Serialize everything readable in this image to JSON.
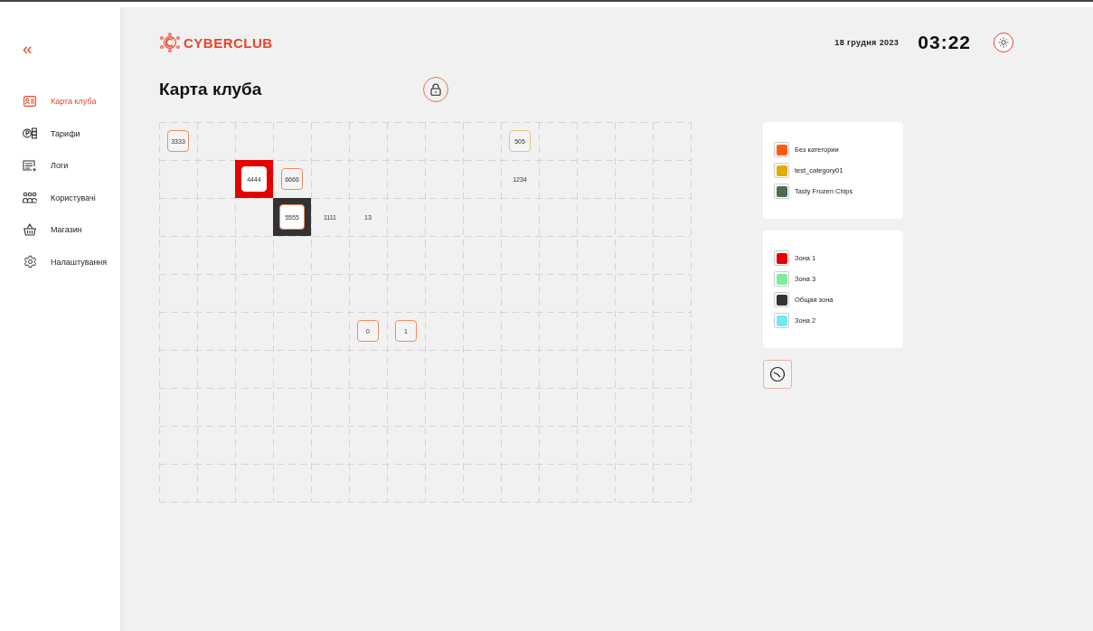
{
  "sidebar": {
    "collapse": "«",
    "items": [
      {
        "label": "Карта клуба",
        "selected": true
      },
      {
        "label": "Тарифи",
        "selected": false
      },
      {
        "label": "Логи",
        "selected": false
      },
      {
        "label": "Користувачі",
        "selected": false
      },
      {
        "label": "Магазин",
        "selected": false
      },
      {
        "label": "Налаштування",
        "selected": false
      }
    ]
  },
  "header": {
    "logo": "CYBERCLUB",
    "date": "18 грудня 2023",
    "time": "03:22"
  },
  "page": {
    "title": "Карта клуба"
  },
  "map": {
    "rows": [
      [
        {
          "kind": "seat",
          "label": "3333",
          "color": "#f08a5d"
        },
        {
          "kind": "empty"
        },
        {
          "kind": "empty"
        },
        {
          "kind": "empty"
        },
        {
          "kind": "empty"
        },
        {
          "kind": "empty"
        },
        {
          "kind": "empty"
        },
        {
          "kind": "empty"
        },
        {
          "kind": "empty"
        },
        {
          "kind": "seat",
          "label": "505",
          "color": "#e2c77a"
        },
        {
          "kind": "empty"
        },
        {
          "kind": "empty"
        },
        {
          "kind": "empty"
        },
        {
          "kind": "empty"
        }
      ],
      [
        {
          "kind": "empty"
        },
        {
          "kind": "empty"
        },
        {
          "kind": "seat",
          "label": "4444",
          "color": "#ffffff",
          "zone": {
            "color": "#e60000"
          }
        },
        {
          "kind": "seat",
          "label": "6666",
          "color": "#f08a5d"
        },
        {
          "kind": "empty"
        },
        {
          "kind": "empty"
        },
        {
          "kind": "empty"
        },
        {
          "kind": "empty"
        },
        {
          "kind": "empty"
        },
        {
          "kind": "text",
          "label": "1234"
        },
        {
          "kind": "empty"
        },
        {
          "kind": "empty"
        },
        {
          "kind": "empty"
        },
        {
          "kind": "empty"
        }
      ],
      [
        {
          "kind": "empty"
        },
        {
          "kind": "empty"
        },
        {
          "kind": "empty"
        },
        {
          "kind": "seat",
          "label": "5555",
          "color": "#f08a5d",
          "zone": {
            "color": "#333333"
          }
        },
        {
          "kind": "text",
          "label": "1111"
        },
        {
          "kind": "text",
          "label": "13"
        },
        {
          "kind": "empty"
        },
        {
          "kind": "empty"
        },
        {
          "kind": "empty"
        },
        {
          "kind": "empty"
        },
        {
          "kind": "empty"
        },
        {
          "kind": "empty"
        },
        {
          "kind": "empty"
        },
        {
          "kind": "empty"
        }
      ],
      [
        {
          "kind": "empty"
        },
        {
          "kind": "empty"
        },
        {
          "kind": "empty"
        },
        {
          "kind": "empty"
        },
        {
          "kind": "empty"
        },
        {
          "kind": "empty"
        },
        {
          "kind": "empty"
        },
        {
          "kind": "empty"
        },
        {
          "kind": "empty"
        },
        {
          "kind": "empty"
        },
        {
          "kind": "empty"
        },
        {
          "kind": "empty"
        },
        {
          "kind": "empty"
        },
        {
          "kind": "empty"
        }
      ],
      [
        {
          "kind": "empty"
        },
        {
          "kind": "empty"
        },
        {
          "kind": "empty"
        },
        {
          "kind": "empty"
        },
        {
          "kind": "empty"
        },
        {
          "kind": "empty"
        },
        {
          "kind": "empty"
        },
        {
          "kind": "empty"
        },
        {
          "kind": "empty"
        },
        {
          "kind": "empty"
        },
        {
          "kind": "empty"
        },
        {
          "kind": "empty"
        },
        {
          "kind": "empty"
        },
        {
          "kind": "empty"
        }
      ],
      [
        {
          "kind": "empty"
        },
        {
          "kind": "empty"
        },
        {
          "kind": "empty"
        },
        {
          "kind": "empty"
        },
        {
          "kind": "empty"
        },
        {
          "kind": "seat",
          "label": "0",
          "color": "#f08a5d"
        },
        {
          "kind": "seat",
          "label": "1",
          "color": "#f08a5d"
        },
        {
          "kind": "empty"
        },
        {
          "kind": "empty"
        },
        {
          "kind": "empty"
        },
        {
          "kind": "empty"
        },
        {
          "kind": "empty"
        },
        {
          "kind": "empty"
        },
        {
          "kind": "empty"
        }
      ],
      [
        {
          "kind": "empty"
        },
        {
          "kind": "empty"
        },
        {
          "kind": "empty"
        },
        {
          "kind": "empty"
        },
        {
          "kind": "empty"
        },
        {
          "kind": "empty"
        },
        {
          "kind": "empty"
        },
        {
          "kind": "empty"
        },
        {
          "kind": "empty"
        },
        {
          "kind": "empty"
        },
        {
          "kind": "empty"
        },
        {
          "kind": "empty"
        },
        {
          "kind": "empty"
        },
        {
          "kind": "empty"
        }
      ],
      [
        {
          "kind": "empty"
        },
        {
          "kind": "empty"
        },
        {
          "kind": "empty"
        },
        {
          "kind": "empty"
        },
        {
          "kind": "empty"
        },
        {
          "kind": "empty"
        },
        {
          "kind": "empty"
        },
        {
          "kind": "empty"
        },
        {
          "kind": "empty"
        },
        {
          "kind": "empty"
        },
        {
          "kind": "empty"
        },
        {
          "kind": "empty"
        },
        {
          "kind": "empty"
        },
        {
          "kind": "empty"
        }
      ],
      [
        {
          "kind": "empty"
        },
        {
          "kind": "empty"
        },
        {
          "kind": "empty"
        },
        {
          "kind": "empty"
        },
        {
          "kind": "empty"
        },
        {
          "kind": "empty"
        },
        {
          "kind": "empty"
        },
        {
          "kind": "empty"
        },
        {
          "kind": "empty"
        },
        {
          "kind": "empty"
        },
        {
          "kind": "empty"
        },
        {
          "kind": "empty"
        },
        {
          "kind": "empty"
        },
        {
          "kind": "empty"
        }
      ],
      [
        {
          "kind": "empty"
        },
        {
          "kind": "empty"
        },
        {
          "kind": "empty"
        },
        {
          "kind": "empty"
        },
        {
          "kind": "empty"
        },
        {
          "kind": "empty"
        },
        {
          "kind": "empty"
        },
        {
          "kind": "empty"
        },
        {
          "kind": "empty"
        },
        {
          "kind": "empty"
        },
        {
          "kind": "empty"
        },
        {
          "kind": "empty"
        },
        {
          "kind": "empty"
        },
        {
          "kind": "empty"
        }
      ]
    ]
  },
  "categories": [
    {
      "label": "Без категории",
      "color": "#ff5a0f"
    },
    {
      "label": "test_category01",
      "color": "#e0ac00"
    },
    {
      "label": "Tasty Frozen Chips",
      "color": "#4d6b4f"
    }
  ],
  "zones": [
    {
      "label": "Зона 1",
      "color": "#e60000"
    },
    {
      "label": "Зона 3",
      "color": "#7eeaa0"
    },
    {
      "label": "Общая зона",
      "color": "#333333"
    },
    {
      "label": "Зона 2",
      "color": "#6eeaf2"
    }
  ]
}
